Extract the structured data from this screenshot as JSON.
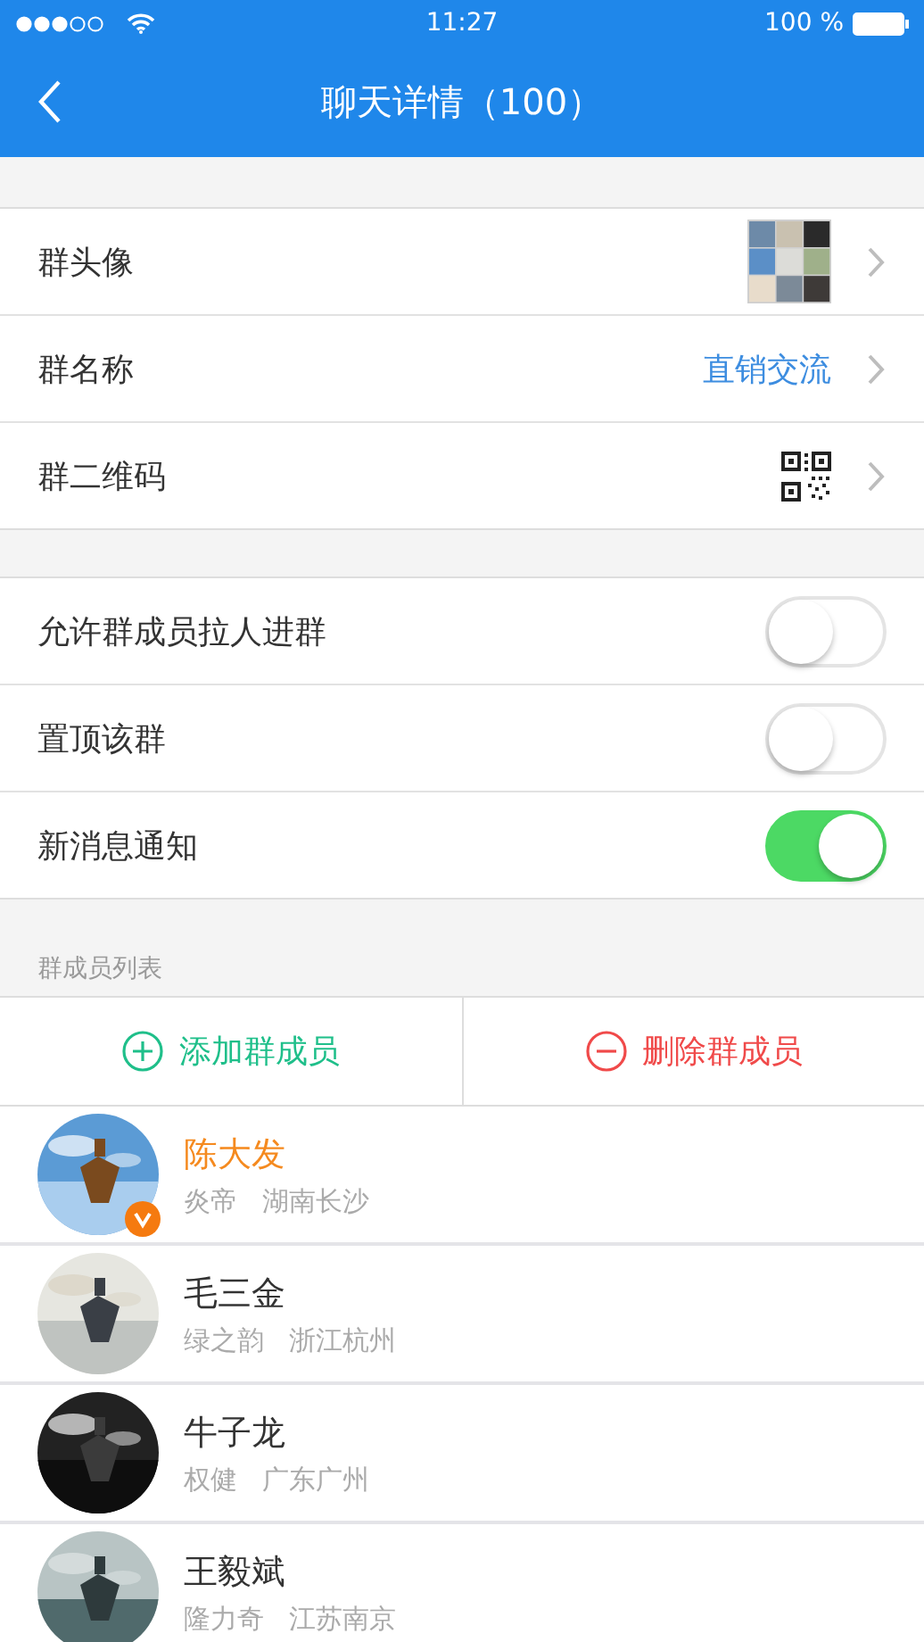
{
  "status_bar": {
    "time": "11:27",
    "battery": "100 %"
  },
  "nav": {
    "title": "聊天详情（100）"
  },
  "info_rows": [
    {
      "kind": "avatar",
      "label": "群头像"
    },
    {
      "kind": "text",
      "label": "群名称",
      "value": "直销交流"
    },
    {
      "kind": "qr",
      "label": "群二维码"
    }
  ],
  "settings": [
    {
      "label": "允许群成员拉人进群",
      "on": false
    },
    {
      "label": "置顶该群",
      "on": false
    },
    {
      "label": "新消息通知",
      "on": true
    }
  ],
  "members_section": {
    "title": "群成员列表",
    "add": "添加群成员",
    "remove": "删除群成员"
  },
  "members": [
    {
      "name": "陈大发",
      "nickname": "炎帝",
      "city": "湖南长沙",
      "highlighted": true,
      "verified": true
    },
    {
      "name": "毛三金",
      "nickname": "绿之韵",
      "city": "浙江杭州",
      "highlighted": false,
      "verified": false
    },
    {
      "name": "牛子龙",
      "nickname": "权健",
      "city": "广东广州",
      "highlighted": false,
      "verified": false
    },
    {
      "name": "王毅斌",
      "nickname": "隆力奇",
      "city": "江苏南京",
      "highlighted": false,
      "verified": false
    }
  ]
}
